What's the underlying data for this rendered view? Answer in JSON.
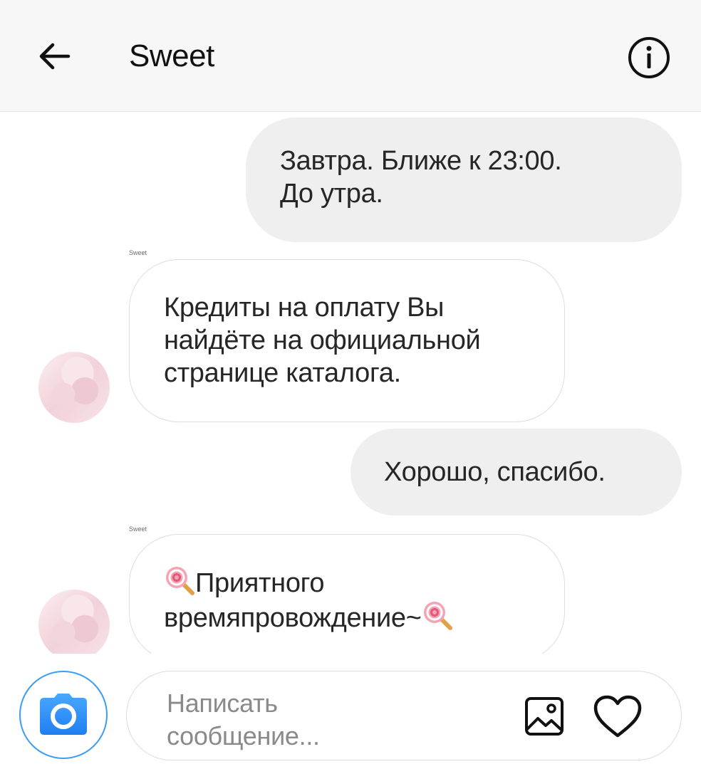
{
  "header": {
    "back_icon": "arrow-left-icon",
    "title": "Sweet",
    "info_icon": "info-icon"
  },
  "messages": [
    {
      "direction": "outgoing",
      "lines": [
        "Завтра. Ближе к 23:00.",
        "До утра."
      ]
    },
    {
      "direction": "incoming",
      "sender": "Sweet",
      "lines": [
        "Кредиты на оплату Вы",
        "найдёте на официальной",
        "странице каталога."
      ]
    },
    {
      "direction": "outgoing",
      "lines": [
        "Хорошо, спасибо."
      ]
    },
    {
      "direction": "incoming",
      "sender": "Sweet",
      "lines": [
        "Приятного",
        "времяпровождение~"
      ],
      "emoji": "lollipop-icon"
    }
  ],
  "composer": {
    "camera_icon": "camera-icon",
    "placeholder_line1": "Написать",
    "placeholder_line2": "сообщение...",
    "gallery_icon": "image-icon",
    "heart_icon": "heart-icon"
  },
  "colors": {
    "accent": "#3b9df5",
    "outgoing_bubble": "#efeff0",
    "header_bg": "#f7f7f8"
  }
}
